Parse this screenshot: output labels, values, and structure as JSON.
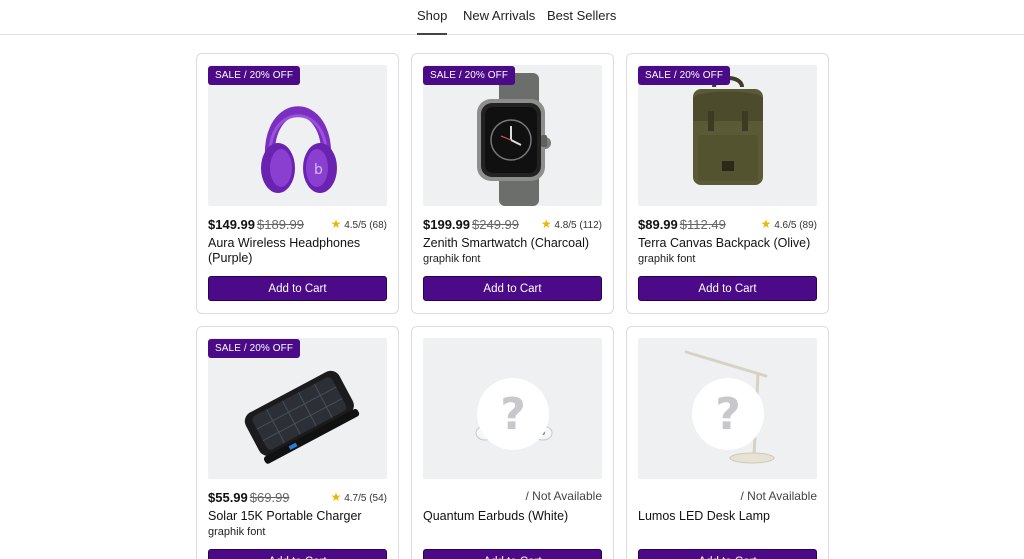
{
  "nav": {
    "items": [
      {
        "label": "Shop",
        "active": true
      },
      {
        "label": "New Arrivals",
        "active": false
      },
      {
        "label": "Best Sellers",
        "active": false
      }
    ]
  },
  "products": [
    {
      "badge": "SALE / 20% OFF",
      "price": "$149.99",
      "old_price": "$189.99",
      "rating": "4.5/5 (68)",
      "name": "Aura Wireless Headphones (Purple)",
      "sub": "",
      "available_text": "",
      "button": "Add to Cart",
      "icon": "headphones-icon"
    },
    {
      "badge": "SALE / 20% OFF",
      "price": "$199.99",
      "old_price": "$249.99",
      "rating": "4.8/5 (112)",
      "name": "Zenith Smartwatch (Charcoal)",
      "sub": "graphik font",
      "available_text": "",
      "button": "Add to Cart",
      "icon": "smartwatch-icon"
    },
    {
      "badge": "SALE / 20% OFF",
      "price": "$89.99",
      "old_price": "$112.49",
      "rating": "4.6/5 (89)",
      "name": "Terra Canvas Backpack (Olive)",
      "sub": "graphik font",
      "available_text": "",
      "button": "Add to Cart",
      "icon": "backpack-icon"
    },
    {
      "badge": "SALE / 20% OFF",
      "price": "$55.99",
      "old_price": "$69.99",
      "rating": "4.7/5 (54)",
      "name": "Solar 15K Portable Charger",
      "sub": "graphik font",
      "available_text": "",
      "button": "Add to Cart",
      "icon": "power-bank-icon"
    },
    {
      "badge": "",
      "price": "",
      "old_price": "",
      "rating": "",
      "name": "Quantum Earbuds (White)",
      "sub": "",
      "available_text": "/ Not Available",
      "button": "Add to Cart",
      "icon": "earbuds-icon"
    },
    {
      "badge": "",
      "price": "",
      "old_price": "",
      "rating": "",
      "name": "Lumos LED Desk Lamp",
      "sub": "",
      "available_text": "/ Not Available",
      "button": "Add to Cart",
      "icon": "desk-lamp-icon"
    }
  ],
  "colors": {
    "accent": "#4b0a87",
    "star": "#f2b400"
  }
}
